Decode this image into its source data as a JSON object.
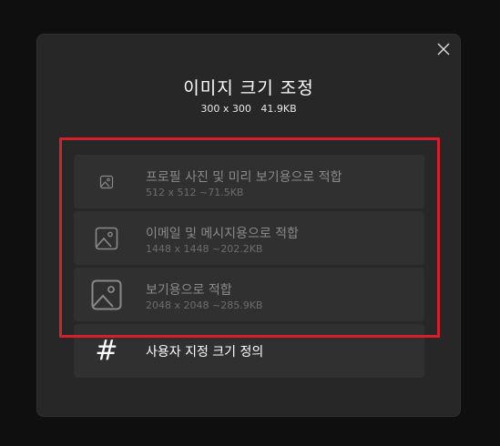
{
  "dialog": {
    "title": "이미지 크기 조정",
    "subtitle": "300 x 300   41.9KB",
    "close_icon": "close-icon"
  },
  "options": [
    {
      "label": "프로필 사진 및 미리 보기용으로 적합",
      "sub": "512 x 512   ~71.5KB",
      "icon": "image-icon-small"
    },
    {
      "label": "이메일 및 메시지용으로 적합",
      "sub": "1448 x 1448   ~202.2KB",
      "icon": "image-icon-medium"
    },
    {
      "label": "보기용으로 적합",
      "sub": "2048 x 2048   ~285.9KB",
      "icon": "image-icon-large"
    },
    {
      "label": "사용자 지정 크기 정의",
      "icon_glyph": "#",
      "icon": "hash-icon"
    }
  ],
  "colors": {
    "dialog_bg": "#272727",
    "option_bg": "#303030",
    "highlight": "#d5202b"
  }
}
